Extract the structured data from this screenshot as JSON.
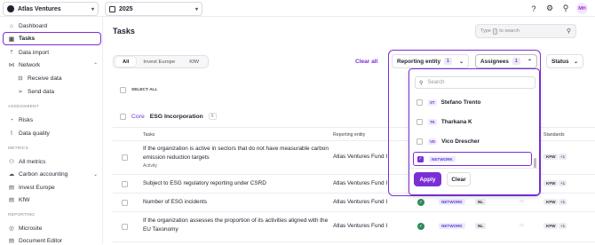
{
  "topbar": {
    "org": "Atlas Ventures",
    "year": "2025",
    "avatar": "MH",
    "icons": [
      "help-icon",
      "settings-icon",
      "user-add-icon"
    ]
  },
  "sidebar": {
    "items": [
      {
        "label": "Dashboard",
        "icon": "home-icon"
      },
      {
        "label": "Tasks",
        "icon": "tasks-icon"
      },
      {
        "label": "Data import",
        "icon": "upload-icon"
      },
      {
        "label": "Network",
        "icon": "network-icon"
      },
      {
        "label": "Receive data",
        "icon": "inbox-icon"
      },
      {
        "label": "Send data",
        "icon": "send-icon"
      }
    ],
    "sections": {
      "assessment": "ASSESSMENT",
      "metrics": "METRICS",
      "reporting": "REPORTING"
    },
    "assessment_items": [
      {
        "label": "Risks",
        "icon": "risk-icon"
      },
      {
        "label": "Data quality",
        "icon": "chart-icon"
      }
    ],
    "metrics_items": [
      {
        "label": "All metrics",
        "icon": "metrics-icon"
      },
      {
        "label": "Carbon accounting",
        "icon": "carbon-icon"
      },
      {
        "label": "Invest Europe",
        "icon": "doc-icon"
      },
      {
        "label": "KfW",
        "icon": "doc-icon"
      }
    ],
    "reporting_items": [
      {
        "label": "Microsite",
        "icon": "globe-icon"
      },
      {
        "label": "Document Editor",
        "icon": "doc-icon"
      }
    ]
  },
  "main": {
    "title": "Tasks",
    "search": {
      "prefix": "Type",
      "key": "/",
      "suffix": "to search"
    },
    "tabs": [
      "All",
      "Invest Europe",
      "KfW"
    ],
    "clear_all": "Clear all",
    "filters": {
      "reporting_entity": {
        "label": "Reporting entity",
        "count": "1"
      },
      "assignees": {
        "label": "Assignees",
        "count": "1"
      },
      "status": {
        "label": "Status"
      }
    },
    "select_all": "SELECT ALL",
    "group": {
      "prefix": "Core",
      "name": "ESG Incorporation",
      "count": "6"
    },
    "columns": {
      "tasks": "Tasks",
      "entity": "Reporting entity",
      "standards": "Standards"
    },
    "rows": [
      {
        "task": "If the organization is active in sectors that do not have measurable carbon emission reduction targets",
        "tag": "Activity",
        "entity": "Atlas Ventures Fund I",
        "network": "NETWORK",
        "country": "NL",
        "standard": "KFW",
        "plus": "+1"
      },
      {
        "task": "Subject to ESG regulatory reporting under CSRD",
        "entity": "Atlas Ventures Fund I",
        "network": "NETWORK",
        "country": "NL",
        "standard": "KFW",
        "plus": "+1"
      },
      {
        "task": "Number of ESG incidents",
        "entity": "Atlas Ventures Fund I",
        "network": "NETWORK",
        "country": "NL",
        "standard": "KFW",
        "plus": "+1"
      },
      {
        "task": "If the organization assesses the proportion of its activities aligned with the EU Taxonomy",
        "entity": "Atlas Ventures Fund I",
        "network": "NETWORK",
        "country": "NL",
        "standard": "KFW",
        "plus": "+1"
      }
    ]
  },
  "dropdown": {
    "search_placeholder": "Search",
    "options": [
      {
        "initials": "ST",
        "label": "Stefano Trento"
      },
      {
        "initials": "TK",
        "label": "Tharkana K"
      },
      {
        "initials": "VD",
        "label": "Vico Drescher"
      }
    ],
    "selected": "NETWORK",
    "apply": "Apply",
    "clear": "Clear"
  },
  "colors": {
    "accent": "#7b2ed6",
    "success": "#2e8b57"
  }
}
